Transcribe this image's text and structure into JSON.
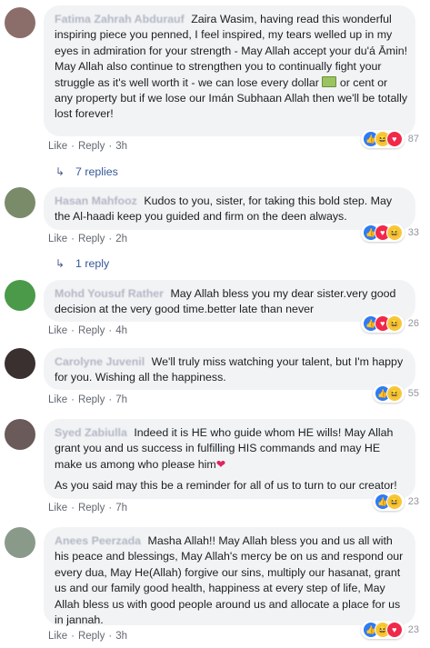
{
  "comments": [
    {
      "author": "Fatima Zahrah Abdurauf",
      "text1": "Zaira Wasim, having read this wonderful inspiring piece you penned, I feel inspired, my tears welled up in my eyes in admiration for your strength - May Allah accept your du'á Āmin!",
      "text2a": "May Allah also continue to strengthen you to continually fight your struggle as it's well worth it - we can lose every dollar",
      "text2b": "or cent or any property but if we lose our Imán Subhaan Allah then we'll be totally lost forever!",
      "like": "Like",
      "reply": "Reply",
      "time": "3h",
      "reactions": "87",
      "replies": "7 replies",
      "avatar_color": "#8b6e6a"
    },
    {
      "author": "Hasan Mahfooz",
      "text1": "Kudos to you, sister, for taking this bold step. May the Al-haadi keep you guided and firm on the deen always.",
      "like": "Like",
      "reply": "Reply",
      "time": "2h",
      "reactions": "33",
      "replies": "1 reply",
      "avatar_color": "#7a8b6a"
    },
    {
      "author": "Mohd Yousuf Rather",
      "text1": "May Allah bless you my dear sister.very good decision at the very good time.better late than never",
      "like": "Like",
      "reply": "Reply",
      "time": "4h",
      "reactions": "26",
      "avatar_color": "#4a9a4a"
    },
    {
      "author": "Carolyne Juvenil",
      "text1": "We'll truly miss watching your talent, but I'm happy for you. Wishing all the happiness.",
      "like": "Like",
      "reply": "Reply",
      "time": "7h",
      "reactions": "55",
      "avatar_color": "#3a3030"
    },
    {
      "author": "Syed Zabiulla",
      "text1": "Indeed it is HE who guide whom HE wills! May Allah grant you and us success in fulfilling HIS commands and may HE make us among who please him",
      "text2": "As you said may this be a reminder for all of us to turn to our creator!",
      "like": "Like",
      "reply": "Reply",
      "time": "7h",
      "reactions": "23",
      "avatar_color": "#6a5a5a"
    },
    {
      "author": "Anees Peerzada",
      "text1": "Masha Allah!! May Allah bless you and us all with his peace and blessings, May Allah's mercy be on us and respond our every dua, May He(Allah) forgive our sins, multiply our hasanat, grant us and our family good health, happiness at every step of life, May Allah bless us with good people around us and allocate a place for us in jannah.",
      "like": "Like",
      "reply": "Reply",
      "time": "3h",
      "reactions": "23",
      "avatar_color": "#8a9a8a"
    }
  ],
  "separator": "·"
}
